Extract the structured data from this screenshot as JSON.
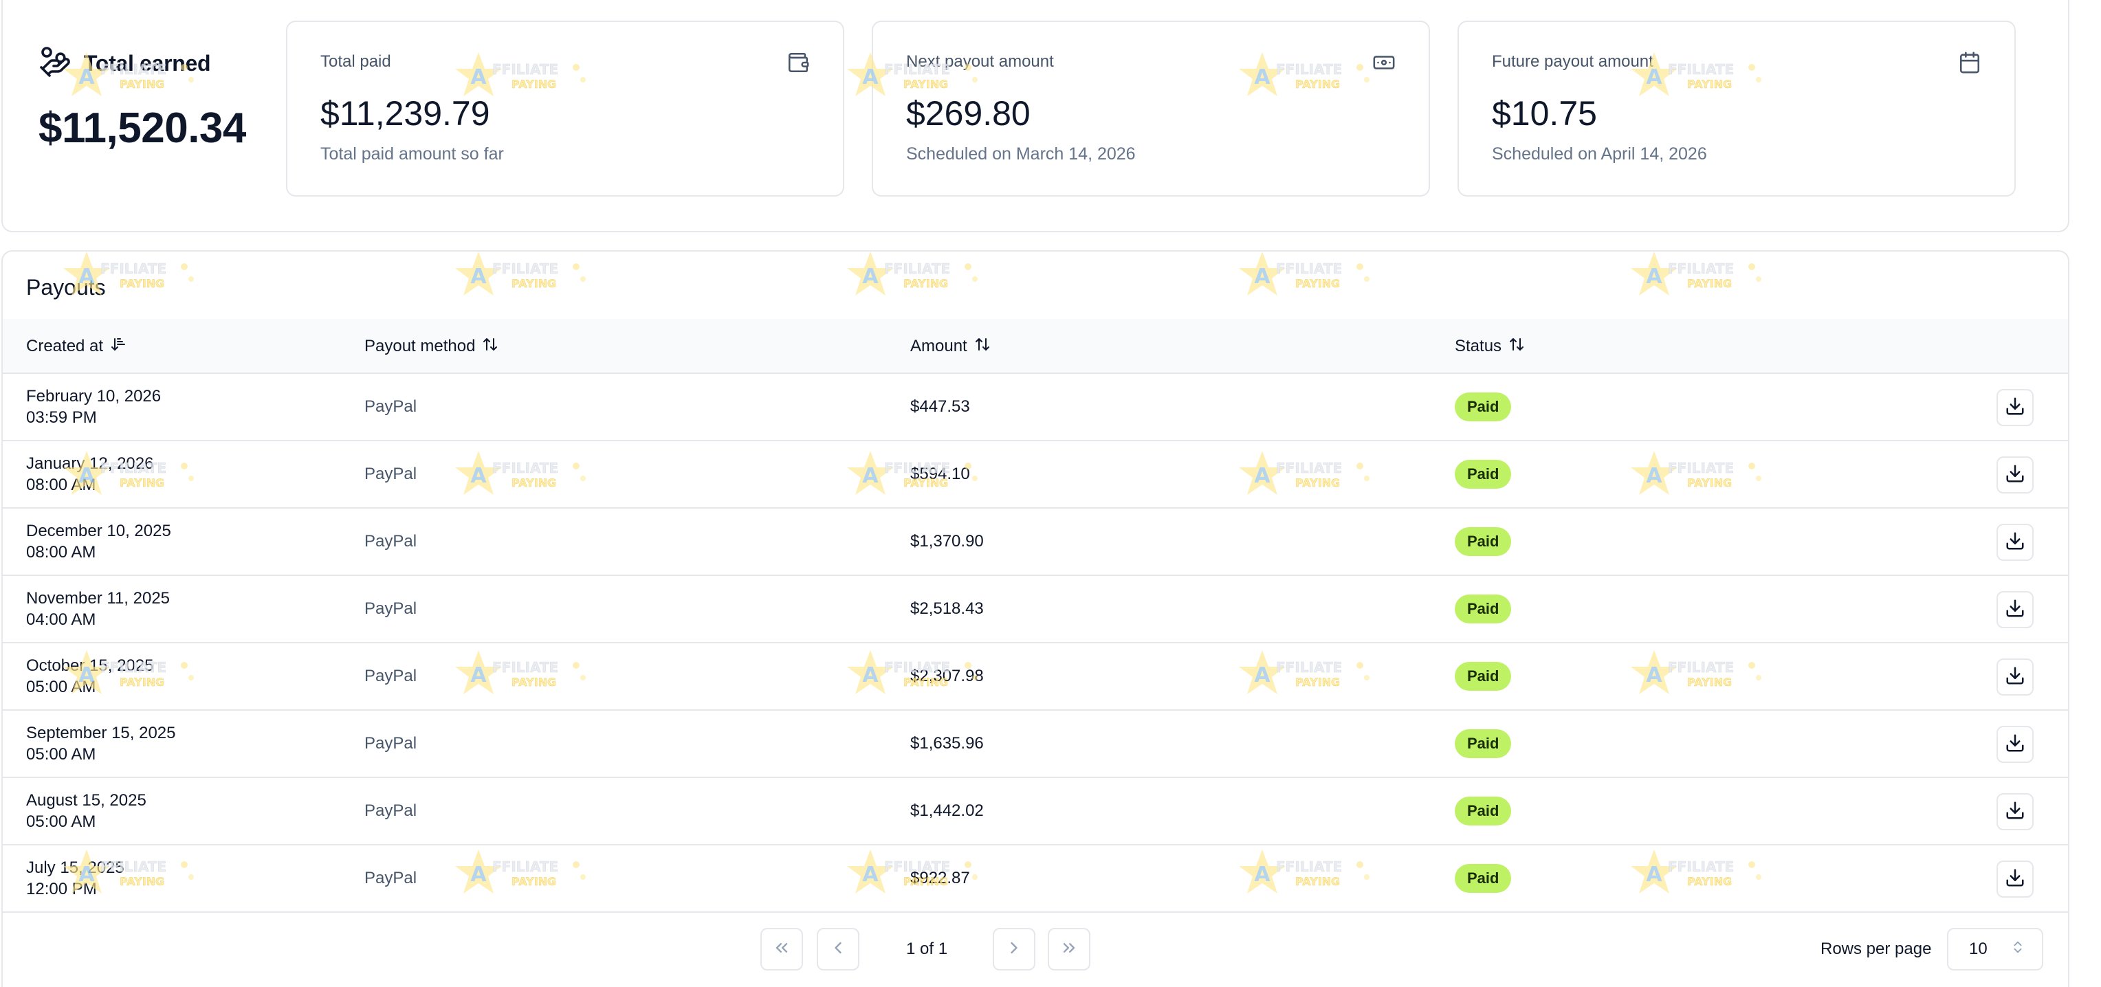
{
  "summary": {
    "total_earned_label": "Total earned",
    "total_earned_amount": "$11,520.34",
    "cards": [
      {
        "label": "Total paid",
        "value": "$11,239.79",
        "sub": "Total paid amount so far",
        "icon": "wallet-icon"
      },
      {
        "label": "Next payout amount",
        "value": "$269.80",
        "sub": "Scheduled on March 14, 2026",
        "icon": "banknote-icon"
      },
      {
        "label": "Future payout amount",
        "value": "$10.75",
        "sub": "Scheduled on April 14, 2026",
        "icon": "calendar-icon"
      }
    ]
  },
  "payouts": {
    "title": "Payouts",
    "columns": [
      "Created at",
      "Payout method",
      "Amount",
      "Status"
    ],
    "rows": [
      {
        "date": "February 10, 2026",
        "time": "03:59 PM",
        "method": "PayPal",
        "amount": "$447.53",
        "status": "Paid"
      },
      {
        "date": "January 12, 2026",
        "time": "08:00 AM",
        "method": "PayPal",
        "amount": "$594.10",
        "status": "Paid"
      },
      {
        "date": "December 10, 2025",
        "time": "08:00 AM",
        "method": "PayPal",
        "amount": "$1,370.90",
        "status": "Paid"
      },
      {
        "date": "November 11, 2025",
        "time": "04:00 AM",
        "method": "PayPal",
        "amount": "$2,518.43",
        "status": "Paid"
      },
      {
        "date": "October 15, 2025",
        "time": "05:00 AM",
        "method": "PayPal",
        "amount": "$2,307.98",
        "status": "Paid"
      },
      {
        "date": "September 15, 2025",
        "time": "05:00 AM",
        "method": "PayPal",
        "amount": "$1,635.96",
        "status": "Paid"
      },
      {
        "date": "August 15, 2025",
        "time": "05:00 AM",
        "method": "PayPal",
        "amount": "$1,442.02",
        "status": "Paid"
      },
      {
        "date": "July 15, 2025",
        "time": "12:00 PM",
        "method": "PayPal",
        "amount": "$922.87",
        "status": "Paid"
      }
    ]
  },
  "pagination": {
    "page_info": "1 of 1",
    "rows_per_page_label": "Rows per page",
    "rows_per_page_value": "10"
  },
  "watermark_text": "AFFILIATE PAYING",
  "colors": {
    "paid_badge": "#bef264",
    "border": "#e5e7eb",
    "header_bg": "#f8fafc"
  }
}
